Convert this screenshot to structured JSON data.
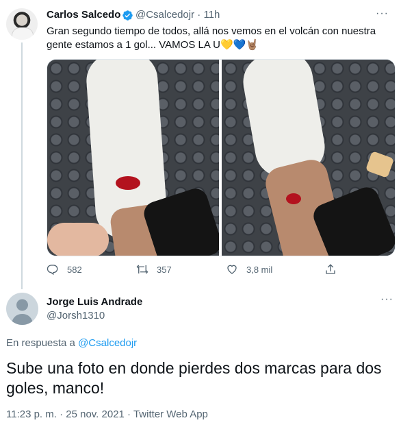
{
  "original_tweet": {
    "author_name": "Carlos Salcedo",
    "verified": true,
    "handle": "@Csalcedojr",
    "separator": "·",
    "time": "11h",
    "more_label": "···",
    "text": "Gran segundo tiempo de todos, allá nos vemos en el volcán con nuestra gente estamos a 1 gol... VAMOS LA U💛💙🤘🏽",
    "photos": [
      "photo-1",
      "photo-2"
    ],
    "stats": {
      "replies": "582",
      "retweets": "357",
      "likes": "3,8 mil"
    }
  },
  "reply_tweet": {
    "author_name": "Jorge Luis Andrade",
    "handle": "@Jorsh1310",
    "more_label": "···",
    "replying_prefix": "En respuesta a",
    "replying_to": "@Csalcedojr",
    "text": "Sube una foto en donde pierdes dos marcas para dos goles, manco!",
    "meta": "11:23 p. m. · 25 nov. 2021 · Twitter Web App"
  },
  "colors": {
    "text": "#0f1419",
    "secondary": "#536471",
    "link": "#1d9bf0",
    "verified": "#1d9bf0"
  }
}
